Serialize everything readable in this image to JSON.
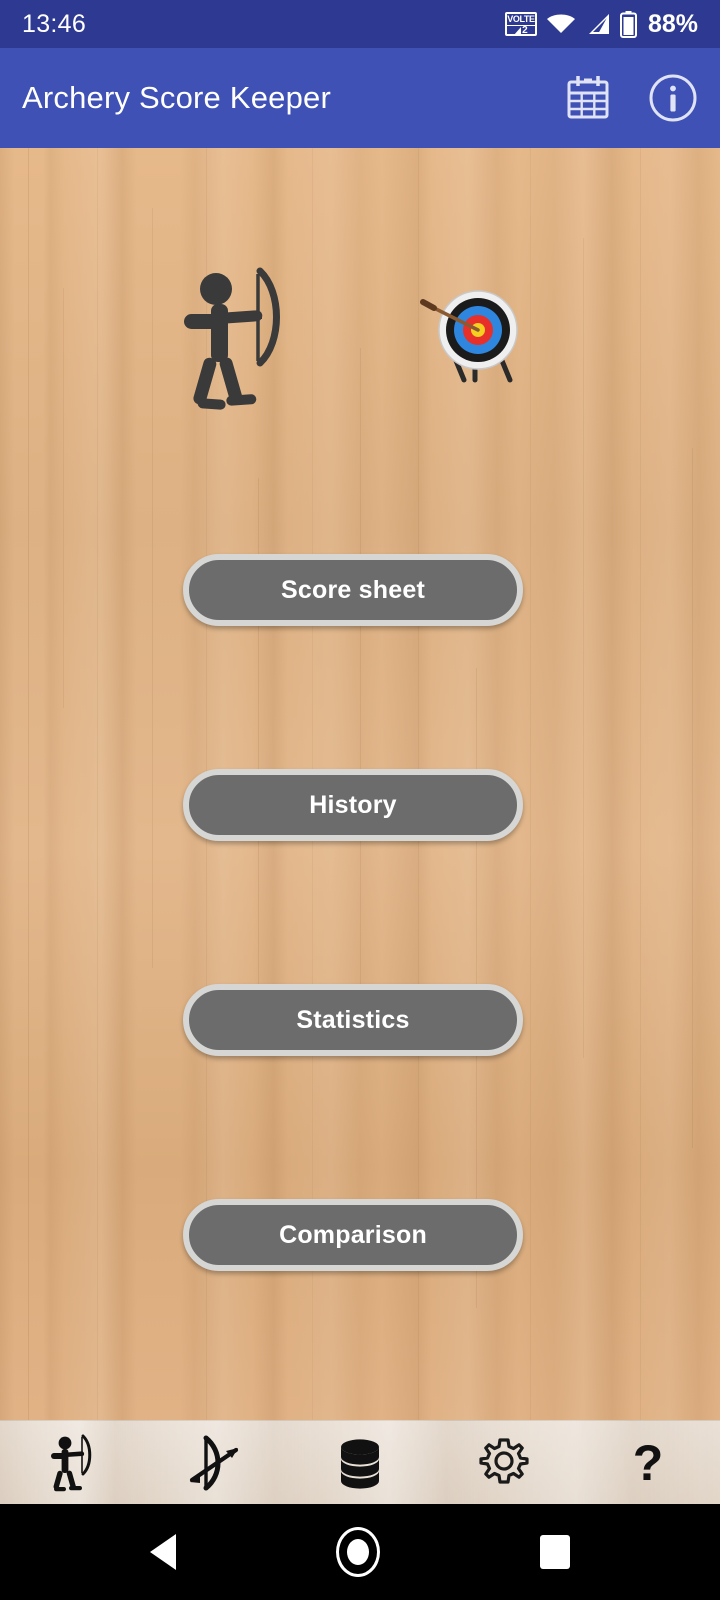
{
  "status_bar": {
    "time": "13:46",
    "battery_percent": "88%",
    "volte_label": "VOLTE",
    "sim_number": "2",
    "icons": [
      "volte-icon",
      "wifi-icon",
      "signal-icon",
      "battery-icon"
    ],
    "background_color": "#2e3a92"
  },
  "app_bar": {
    "title": "Archery Score Keeper",
    "background_color": "#3f51b5",
    "actions": [
      {
        "name": "calendar-icon",
        "label": "Calendar"
      },
      {
        "name": "info-icon",
        "label": "Info"
      }
    ]
  },
  "hero": {
    "archer_label": "archer-figure",
    "target_label": "archery-target"
  },
  "menu": {
    "button_fill": "#6c6c6c",
    "button_border": "#d6d6d4",
    "buttons": [
      {
        "label": "Score sheet",
        "name": "score-sheet-button"
      },
      {
        "label": "History",
        "name": "history-button"
      },
      {
        "label": "Statistics",
        "name": "statistics-button"
      },
      {
        "label": "Comparison",
        "name": "comparison-button"
      }
    ]
  },
  "toolbar": {
    "background_color": "#e6dbcf",
    "items": [
      {
        "label": "Archer",
        "name": "toolbar-archer-icon"
      },
      {
        "label": "Bow and arrow",
        "name": "toolbar-bow-arrow-icon"
      },
      {
        "label": "Database",
        "name": "toolbar-database-icon"
      },
      {
        "label": "Settings",
        "name": "toolbar-gear-icon"
      },
      {
        "label": "Help",
        "name": "toolbar-help-icon",
        "glyph": "?"
      }
    ]
  },
  "android_nav": {
    "background_color": "#000000",
    "buttons": [
      {
        "label": "Back",
        "name": "nav-back-button"
      },
      {
        "label": "Home",
        "name": "nav-home-button"
      },
      {
        "label": "Recents",
        "name": "nav-recents-button"
      }
    ]
  },
  "background": {
    "wood_top": "#e6b98b",
    "wood_bottom": "#e0b285"
  }
}
